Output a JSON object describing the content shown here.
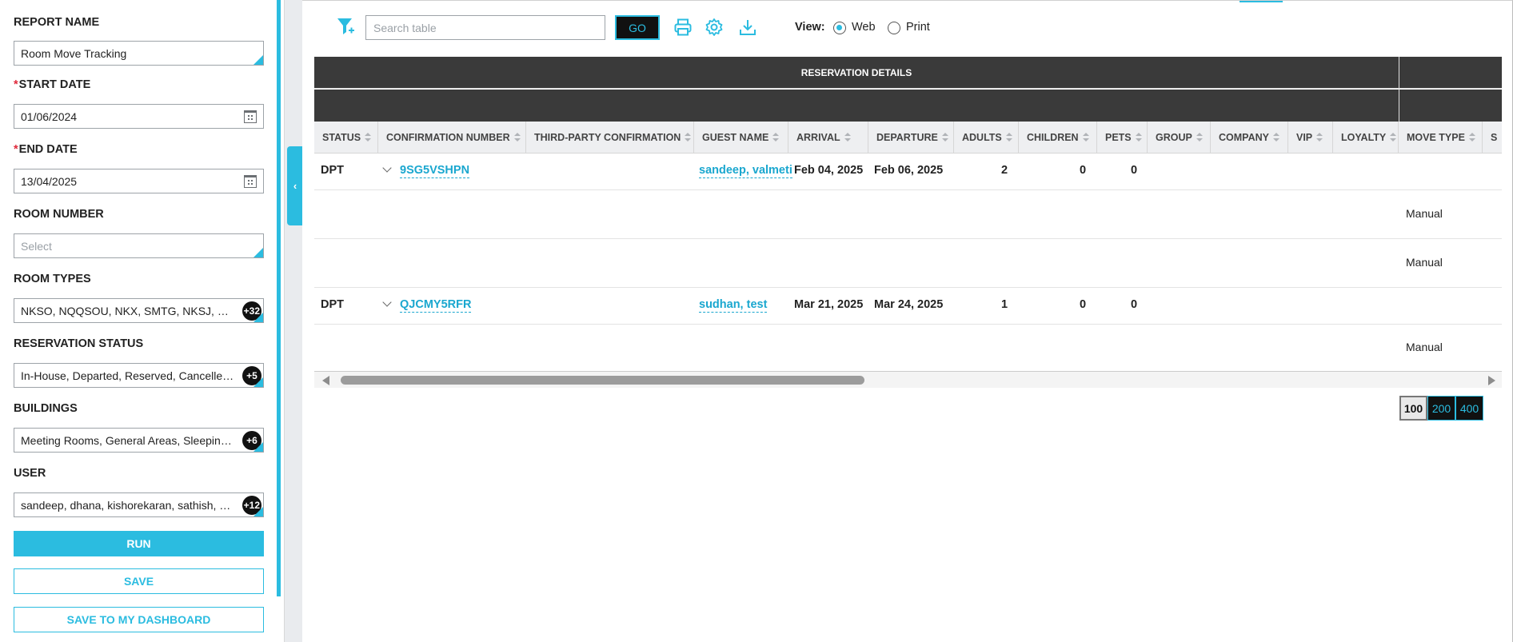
{
  "filters": {
    "report_name_label": "REPORT NAME",
    "report_name_value": "Room Move Tracking",
    "required_mark": "*",
    "start_date_label": "START DATE",
    "start_date_value": "01/06/2024",
    "end_date_label": "END DATE",
    "end_date_value": "13/04/2025",
    "room_number_label": "ROOM NUMBER",
    "room_number_placeholder": "Select",
    "room_types_label": "ROOM TYPES",
    "room_types_value": "NKSO, NQQSOU, NKX, SMTG, NKSJ, NKSX, NQQ",
    "room_types_more": "+32",
    "reservation_status_label": "RESERVATION STATUS",
    "reservation_status_value": "In-House, Departed, Reserved, Cancelled, No Show",
    "reservation_status_more": "+5",
    "buildings_label": "BUILDINGS",
    "buildings_value": "Meeting Rooms, General Areas, Sleeping Rooms",
    "buildings_more": "+6",
    "user_label": "USER",
    "user_value": "sandeep, dhana, kishorekaran, sathish, satzy, test",
    "user_more": "+12",
    "run_label": "RUN",
    "save_label": "SAVE",
    "save_dashboard_label": "SAVE TO MY DASHBOARD"
  },
  "toolbar": {
    "search_placeholder": "Search table",
    "go_label": "GO",
    "view_label": "View:",
    "view_web": "Web",
    "view_print": "Print",
    "selected_view": "Web"
  },
  "table": {
    "group_header": "RESERVATION DETAILS",
    "columns": [
      "STATUS",
      "CONFIRMATION NUMBER",
      "THIRD-PARTY CONFIRMATION",
      "GUEST NAME",
      "ARRIVAL",
      "DEPARTURE",
      "ADULTS",
      "CHILDREN",
      "PETS",
      "GROUP",
      "COMPANY",
      "VIP",
      "LOYALTY",
      "MOVE TYPE",
      "S"
    ],
    "rows": [
      {
        "status": "DPT",
        "confirmation": "9SG5VSHPN",
        "guest": "sandeep, valmeti",
        "arrival": "Feb 04, 2025",
        "departure": "Feb 06, 2025",
        "adults": "2",
        "children": "0",
        "pets": "0",
        "moves": [
          "Manual",
          "Manual"
        ]
      },
      {
        "status": "DPT",
        "confirmation": "QJCMY5RFR",
        "guest": "sudhan, test",
        "arrival": "Mar 21, 2025",
        "departure": "Mar 24, 2025",
        "adults": "1",
        "children": "0",
        "pets": "0",
        "moves": [
          "Manual"
        ]
      }
    ]
  },
  "pagination": {
    "sizes": [
      "100",
      "200",
      "400"
    ],
    "selected": "100"
  },
  "colors": {
    "accent": "#2bbce0",
    "header_dark": "#3a3a3a",
    "link": "#1aa7cf"
  }
}
